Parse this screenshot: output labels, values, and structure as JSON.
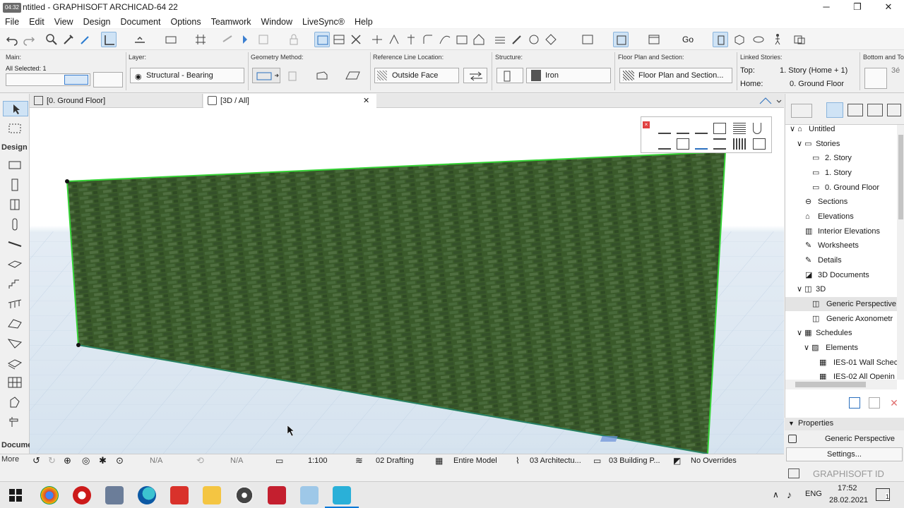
{
  "window": {
    "time_badge": "04:32",
    "title": "ntitled - GRAPHISOFT ARCHICAD-64 22",
    "minimize": "─",
    "restore": "❐",
    "close": "✕"
  },
  "menu": [
    "File",
    "Edit",
    "View",
    "Design",
    "Document",
    "Options",
    "Teamwork",
    "Window",
    "LiveSync®",
    "Help"
  ],
  "toolbar": {
    "go_label": "Go"
  },
  "infobox": {
    "main_label": "Main:",
    "all_selected": "All Selected: 1",
    "layer_label": "Layer:",
    "layer_value": "Structural - Bearing",
    "geometry_label": "Geometry Method:",
    "refline_label": "Reference Line Location:",
    "refline_value": "Outside Face",
    "structure_label": "Structure:",
    "structure_value": "Iron",
    "fps_label": "Floor Plan and Section:",
    "fps_value": "Floor Plan and Section...",
    "linked_label": "Linked Stories:",
    "top_label": "Top:",
    "top_value": "1. Story (Home + 1)",
    "home_label": "Home:",
    "home_value": "0. Ground Floor",
    "bottom_label": "Bottom and To",
    "bottom_value": "3é"
  },
  "tabs": [
    {
      "label": "[0. Ground Floor]"
    },
    {
      "label": "[3D / All]",
      "close": "✕"
    }
  ],
  "toolbox": {
    "design_label": "Design",
    "document_label": "Docume",
    "more_label": "More"
  },
  "navigator": {
    "items": [
      {
        "label": "Untitled",
        "level": 0,
        "arrow": "∨"
      },
      {
        "label": "Stories",
        "level": 1,
        "arrow": "∨"
      },
      {
        "label": "2. Story",
        "level": 2,
        "arrow": ""
      },
      {
        "label": "1. Story",
        "level": 2,
        "arrow": ""
      },
      {
        "label": "0. Ground Floor",
        "level": 2,
        "arrow": ""
      },
      {
        "label": "Sections",
        "level": 1,
        "arrow": ""
      },
      {
        "label": "Elevations",
        "level": 1,
        "arrow": ""
      },
      {
        "label": "Interior Elevations",
        "level": 1,
        "arrow": ""
      },
      {
        "label": "Worksheets",
        "level": 1,
        "arrow": ""
      },
      {
        "label": "Details",
        "level": 1,
        "arrow": ""
      },
      {
        "label": "3D Documents",
        "level": 1,
        "arrow": ""
      },
      {
        "label": "3D",
        "level": 1,
        "arrow": "∨"
      },
      {
        "label": "Generic Perspective",
        "level": 2,
        "arrow": "",
        "selected": true
      },
      {
        "label": "Generic Axonometr",
        "level": 2,
        "arrow": ""
      },
      {
        "label": "Schedules",
        "level": 1,
        "arrow": "∨"
      },
      {
        "label": "Elements",
        "level": 2,
        "arrow": "∨"
      },
      {
        "label": "IES-01 Wall Schec",
        "level": 3,
        "arrow": ""
      },
      {
        "label": "IES-02 All Openin",
        "level": 3,
        "arrow": ""
      }
    ]
  },
  "properties": {
    "title": "Properties",
    "view_name": "Generic Perspective",
    "settings": "Settings...",
    "brand": "GRAPHISOFT ID"
  },
  "statusbar": {
    "na1": "N/A",
    "na2": "N/A",
    "scale": "1:100",
    "drafting": "02 Drafting",
    "model": "Entire Model",
    "arch": "03 Architectu...",
    "building": "03 Building P...",
    "overrides": "No Overrides"
  },
  "taskbar": {
    "lang": "ENG",
    "time": "17:52",
    "date": "28.02.2021",
    "notif": "1"
  },
  "colors": {
    "wall": "#3b5a2a",
    "selection": "#37d237",
    "accent": "#0078d7"
  }
}
